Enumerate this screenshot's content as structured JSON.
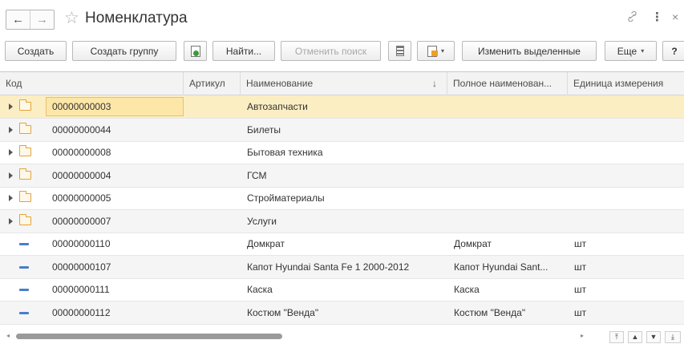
{
  "window": {
    "title": "Номенклатура",
    "back_glyph": "←",
    "forward_glyph": "→",
    "favorite_glyph": "☆",
    "link_glyph": "🔗",
    "more_glyph": "⋮",
    "close_glyph": "×"
  },
  "toolbar": {
    "create": "Создать",
    "create_group": "Создать группу",
    "find": "Найти...",
    "cancel_search": "Отменить поиск",
    "edit_selected": "Изменить выделенные",
    "more": "Еще",
    "help": "?",
    "dropdown_glyph": "▾"
  },
  "table": {
    "columns": [
      "Код",
      "Артикул",
      "Наименование",
      "Полное наименован...",
      "Единица измерения"
    ],
    "sort_indicator": "↓",
    "rows": [
      {
        "type": "group",
        "code": "00000000003",
        "article": "",
        "name": "Автозапчасти",
        "full_name": "",
        "unit": ""
      },
      {
        "type": "group",
        "code": "00000000044",
        "article": "",
        "name": "Билеты",
        "full_name": "",
        "unit": ""
      },
      {
        "type": "group",
        "code": "00000000008",
        "article": "",
        "name": "Бытовая техника",
        "full_name": "",
        "unit": ""
      },
      {
        "type": "group",
        "code": "00000000004",
        "article": "",
        "name": "ГСМ",
        "full_name": "",
        "unit": ""
      },
      {
        "type": "group",
        "code": "00000000005",
        "article": "",
        "name": "Стройматериалы",
        "full_name": "",
        "unit": ""
      },
      {
        "type": "group",
        "code": "00000000007",
        "article": "",
        "name": "Услуги",
        "full_name": "",
        "unit": ""
      },
      {
        "type": "item",
        "code": "00000000110",
        "article": "",
        "name": "Домкрат",
        "full_name": "Домкрат",
        "unit": "шт"
      },
      {
        "type": "item",
        "code": "00000000107",
        "article": "",
        "name": "Капот Hyundai Santa Fe 1 2000-2012",
        "full_name": "Капот Hyundai Sant...",
        "unit": "шт"
      },
      {
        "type": "item",
        "code": "00000000111",
        "article": "",
        "name": "Каска",
        "full_name": "Каска",
        "unit": "шт"
      },
      {
        "type": "item",
        "code": "00000000112",
        "article": "",
        "name": "Костюм \"Венда\"",
        "full_name": "Костюм \"Венда\"",
        "unit": "шт"
      }
    ],
    "selected_row": 0
  },
  "scroll": {
    "first_glyph": "⤒",
    "up_glyph": "▲",
    "down_glyph": "▼",
    "last_glyph": "⤓"
  }
}
